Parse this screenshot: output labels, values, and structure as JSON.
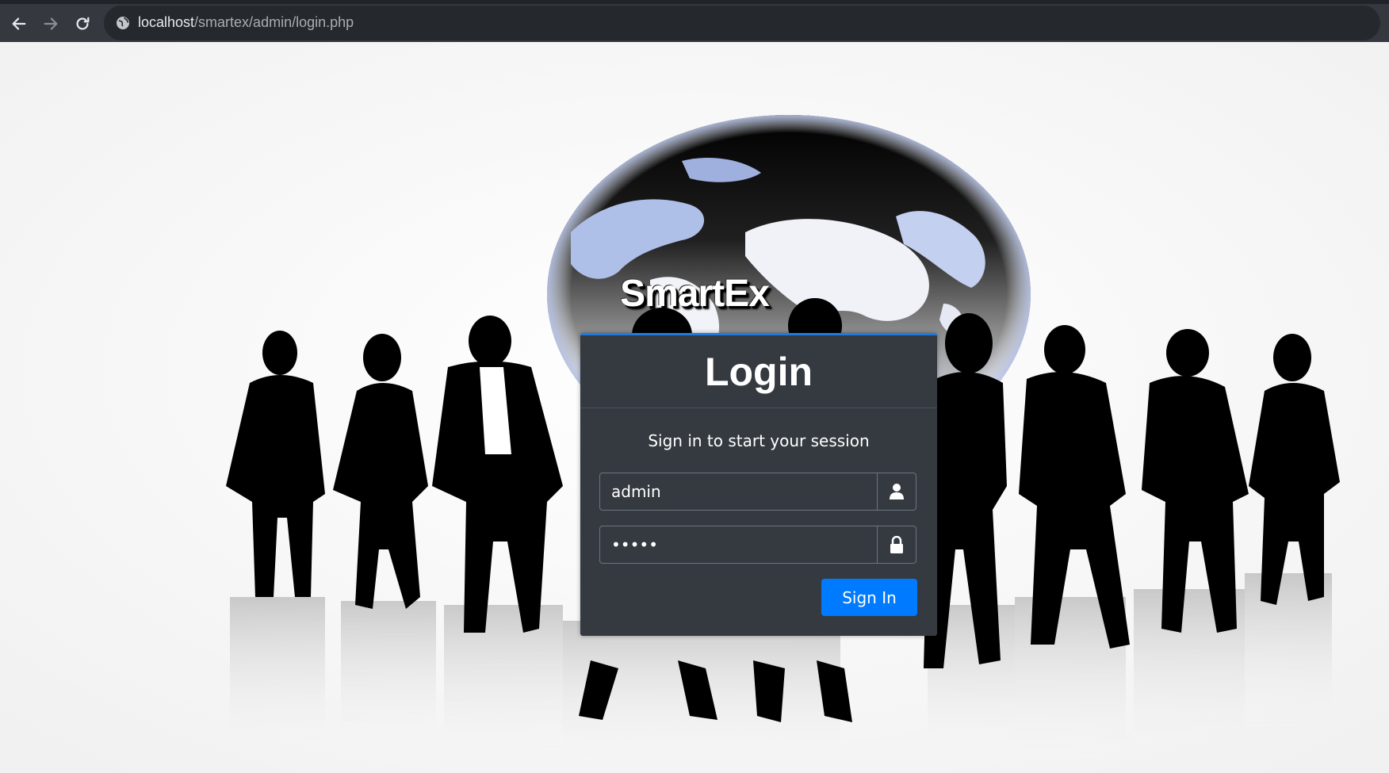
{
  "browser": {
    "url_host": "localhost",
    "url_path": "/smartex/admin/login.php",
    "icons": [
      "back-arrow-icon",
      "forward-arrow-icon",
      "reload-icon",
      "site-info-icon"
    ]
  },
  "brand": {
    "name": "SmartEx"
  },
  "login": {
    "title": "Login",
    "message": "Sign in to start your session",
    "username_value": "admin",
    "password_value": "admin",
    "signin_label": "Sign In",
    "icons": [
      "user-icon",
      "lock-icon"
    ]
  },
  "colors": {
    "card_bg": "#343a40",
    "card_top_border": "#1f7ae0",
    "button": "#007bff",
    "chrome_bg": "#35393f"
  }
}
